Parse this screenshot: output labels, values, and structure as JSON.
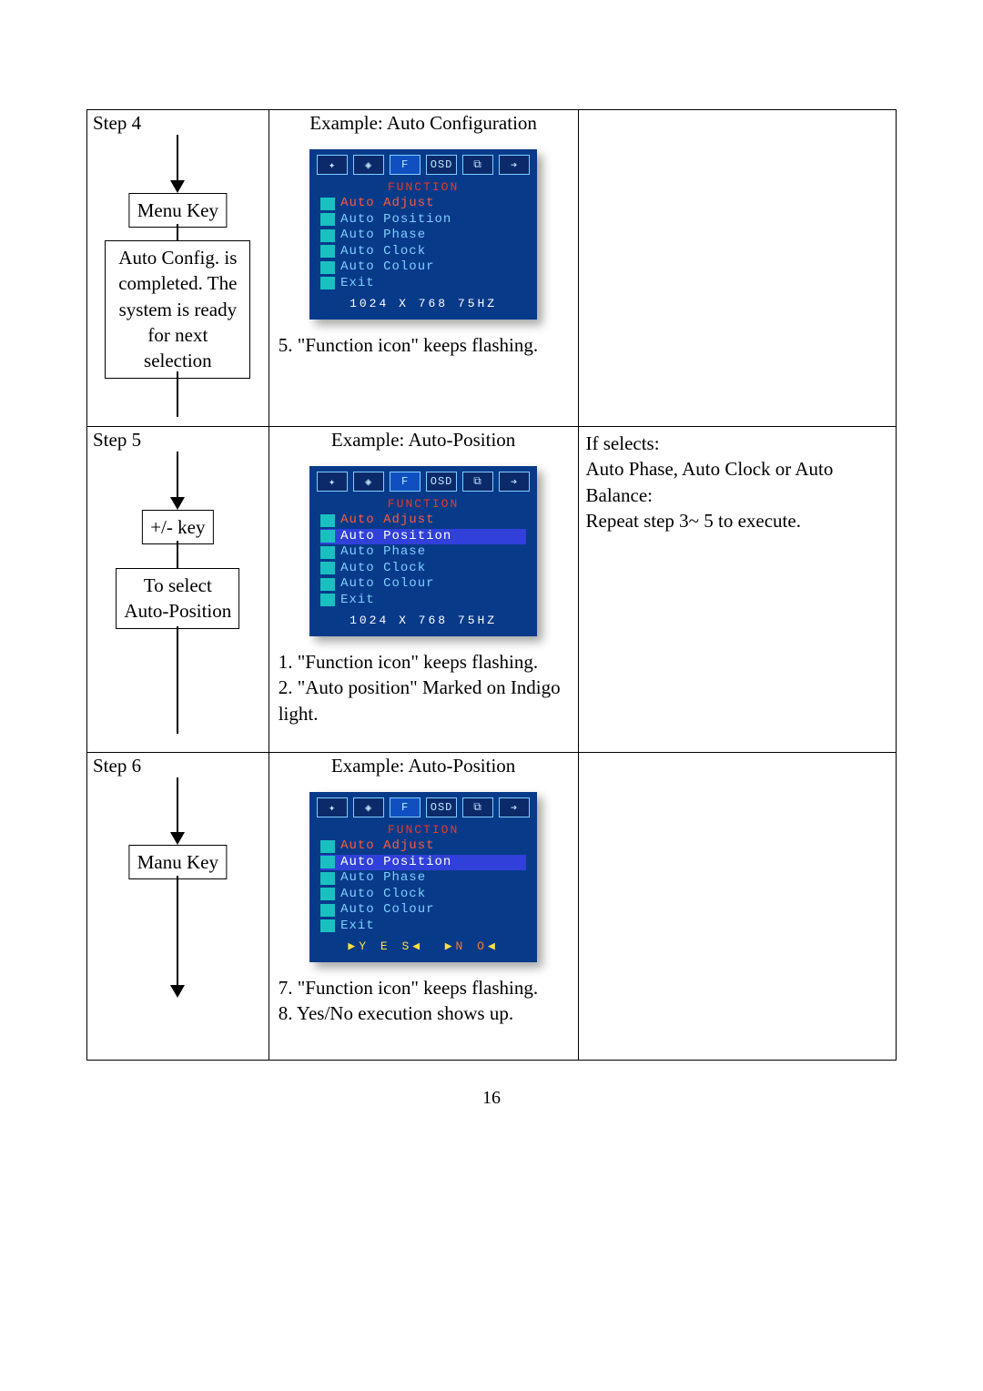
{
  "page_number": "16",
  "rows": [
    {
      "step": "Step 4",
      "example_title": "Example: Auto Configuration",
      "flow_box1": "Menu Key",
      "flow_box2": "Auto Config. is completed. The system is ready for next selection",
      "notes": [
        "5.  \"Function icon\" keeps flashing."
      ],
      "right": "",
      "osd": {
        "section": "FUNCTION",
        "items": [
          {
            "label": "Auto Adjust",
            "style": "red"
          },
          {
            "label": "Auto Position",
            "style": ""
          },
          {
            "label": "Auto Phase",
            "style": ""
          },
          {
            "label": "Auto Clock",
            "style": ""
          },
          {
            "label": "Auto Colour",
            "style": ""
          },
          {
            "label": "Exit",
            "style": ""
          }
        ],
        "status": "1024 X 768 75HZ",
        "yesno": false
      }
    },
    {
      "step": "Step 5",
      "example_title": "Example: Auto-Position",
      "flow_box1": "+/-  key",
      "flow_box2": "To select Auto-Position",
      "notes": [
        "1.  \"Function icon\" keeps flashing.",
        "2.  \"Auto position\" Marked on Indigo light."
      ],
      "right": "If selects:\nAuto Phase, Auto Clock or Auto Balance:\nRepeat step 3~ 5 to execute.",
      "osd": {
        "section": "FUNCTION",
        "items": [
          {
            "label": "Auto Adjust",
            "style": "red"
          },
          {
            "label": "Auto Position",
            "style": "sel"
          },
          {
            "label": "Auto Phase",
            "style": ""
          },
          {
            "label": "Auto Clock",
            "style": ""
          },
          {
            "label": "Auto Colour",
            "style": ""
          },
          {
            "label": "Exit",
            "style": ""
          }
        ],
        "status": "1024 X 768 75HZ",
        "yesno": false
      }
    },
    {
      "step": "Step 6",
      "example_title": "Example: Auto-Position",
      "flow_box1": "Manu Key",
      "flow_box2": "",
      "notes": [
        "7.  \"Function icon\" keeps flashing.",
        "8.  Yes/No execution shows up."
      ],
      "right": "",
      "osd": {
        "section": "FUNCTION",
        "items": [
          {
            "label": "Auto Adjust",
            "style": "red"
          },
          {
            "label": "Auto Position",
            "style": "sel"
          },
          {
            "label": "Auto Phase",
            "style": ""
          },
          {
            "label": "Auto Clock",
            "style": ""
          },
          {
            "label": "Auto Colour",
            "style": ""
          },
          {
            "label": "Exit",
            "style": ""
          }
        ],
        "status": "",
        "yesno": true,
        "yes": "Y E S",
        "no": "N O"
      }
    }
  ]
}
